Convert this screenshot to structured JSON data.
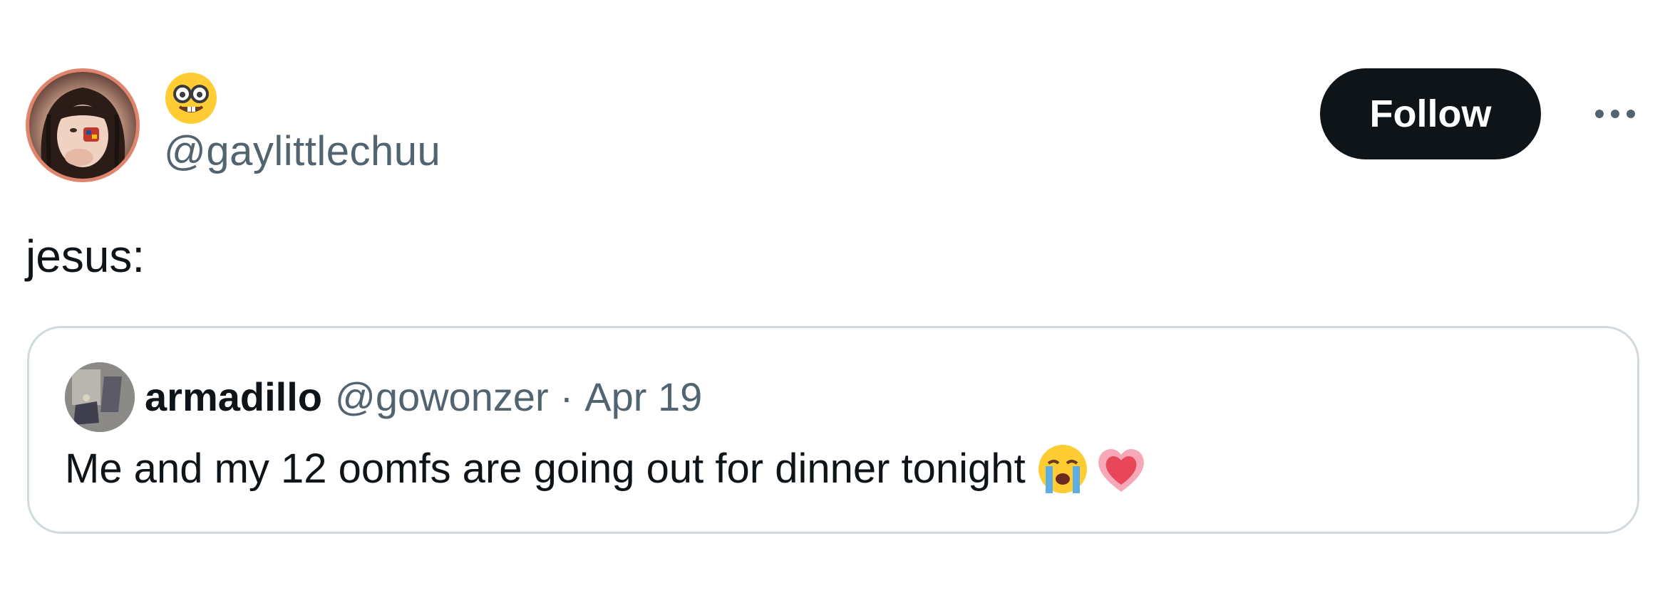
{
  "author": {
    "display_name_emoji": "nerd-face-emoji",
    "handle": "@gaylittlechuu",
    "avatar": "profile-photo"
  },
  "actions": {
    "follow_label": "Follow",
    "more_icon": "more-options-icon"
  },
  "tweet": {
    "text": "jesus:"
  },
  "quoted_tweet": {
    "author_name": "armadillo",
    "author_handle": "@gowonzer",
    "separator": "·",
    "date": "Apr 19",
    "text": "Me and my 12 oomfs are going out for dinner tonight",
    "emojis": [
      "loudly-crying-face-emoji",
      "growing-heart-emoji"
    ]
  },
  "colors": {
    "primary_text": "#0f1419",
    "secondary_text": "#536471",
    "follow_button_bg": "#0f1419",
    "card_border": "#cfd9de"
  }
}
